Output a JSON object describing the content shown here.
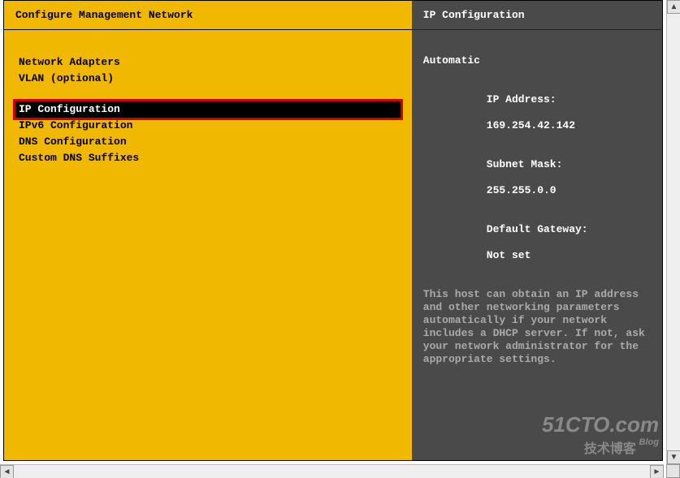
{
  "left": {
    "title": "Configure Management Network",
    "group_a": [
      {
        "label": "Network Adapters",
        "selected": false
      },
      {
        "label": "VLAN (optional)",
        "selected": false
      }
    ],
    "group_b": [
      {
        "label": "IP Configuration",
        "selected": true
      },
      {
        "label": "IPv6 Configuration",
        "selected": false
      },
      {
        "label": "DNS Configuration",
        "selected": false
      },
      {
        "label": "Custom DNS Suffixes",
        "selected": false
      }
    ]
  },
  "right": {
    "title": "IP Configuration",
    "mode": "Automatic",
    "ip_label": "IP Address:",
    "ip_value": "169.254.42.142",
    "mask_label": "Subnet Mask:",
    "mask_value": "255.255.0.0",
    "gw_label": "Default Gateway:",
    "gw_value": "Not set",
    "description": "This host can obtain an IP address and other networking parameters automatically if your network includes a DHCP server. If not, ask your network administrator for the appropriate settings."
  },
  "watermark": {
    "line1": "51CTO.com",
    "line2": "技术博客",
    "tag": "Blog"
  },
  "arrows": {
    "left": "◄",
    "right": "►",
    "up": "▲",
    "down": "▼"
  }
}
